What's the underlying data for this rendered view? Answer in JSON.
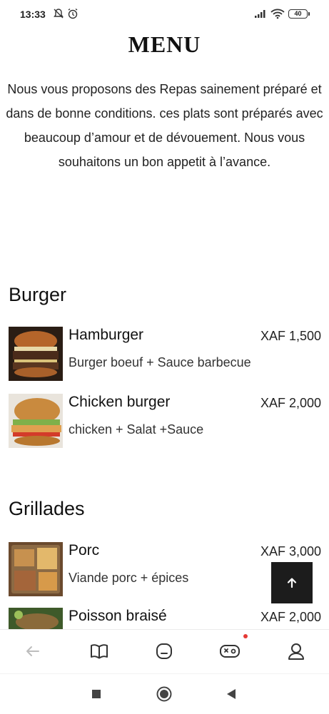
{
  "status_bar": {
    "time": "13:33",
    "battery": "40",
    "icons": [
      "mute-bell-icon",
      "alarm-icon",
      "signal-icon",
      "wifi-icon",
      "battery-icon"
    ]
  },
  "page": {
    "title": "MENU",
    "intro": "Nous vous proposons des Repas sainement préparé et dans de bonne conditions. ces plats sont préparés avec beaucoup d’amour et de dévouement. Nous vous souhaitons un bon appetit à l’avance."
  },
  "sections": [
    {
      "title": "Burger",
      "items": [
        {
          "name": "Hamburger",
          "price": "XAF 1,500",
          "description": "Burger boeuf + Sauce barbecue"
        },
        {
          "name": "Chicken burger",
          "price": "XAF 2,000",
          "description": "chicken + Salat +Sauce"
        }
      ]
    },
    {
      "title": "Grillades",
      "items": [
        {
          "name": "Porc",
          "price": "XAF 3,000",
          "description": "Viande porc + épices"
        },
        {
          "name": "Poisson braisé",
          "price": "XAF 2,000",
          "description": ""
        }
      ]
    }
  ],
  "browser_nav": {
    "buttons": [
      "back-arrow-icon",
      "book-icon",
      "tab-switcher-icon",
      "game-controller-icon",
      "profile-icon"
    ],
    "notification_color": "#e53935"
  },
  "android_nav": {
    "buttons": [
      "recents-square-icon",
      "home-circle-icon",
      "back-triangle-icon"
    ]
  },
  "colors": {
    "text": "#111111",
    "scroll_button_bg": "#1c1c1c"
  }
}
